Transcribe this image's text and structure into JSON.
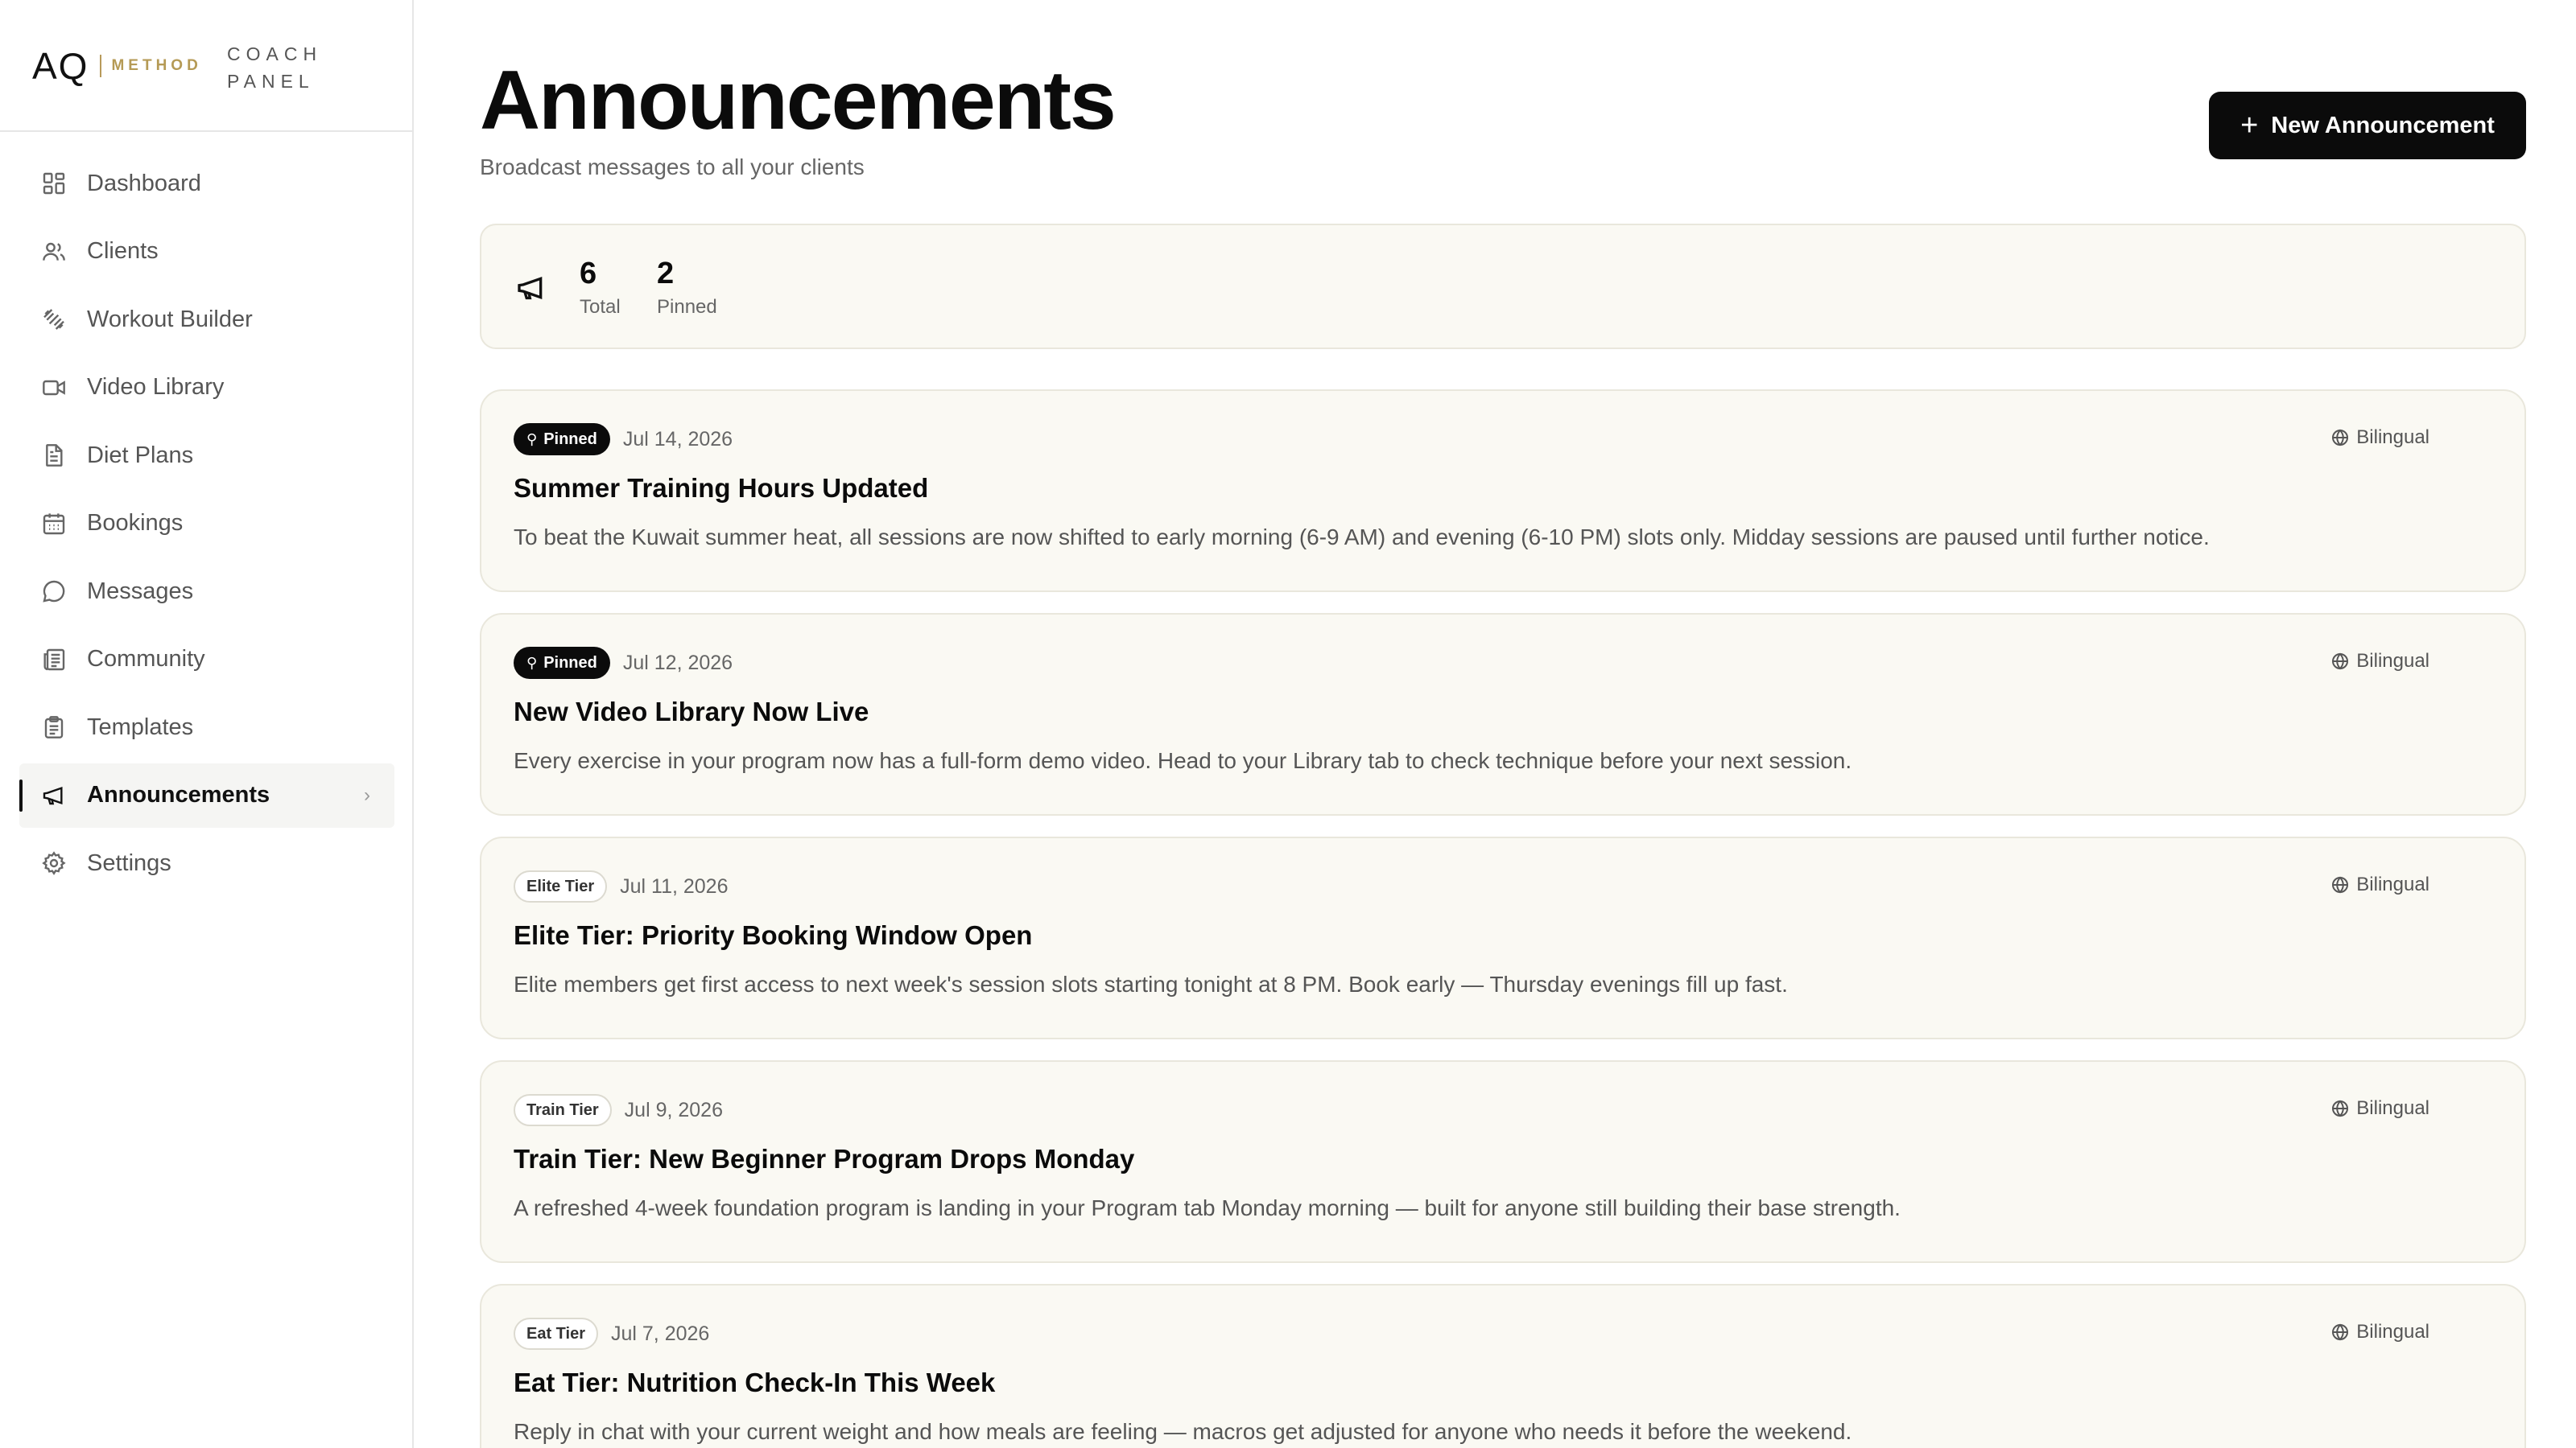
{
  "brand": {
    "logo": "AQ",
    "method": "METHOD",
    "panel_line1": "COACH",
    "panel_line2": "PANEL"
  },
  "sidebar": {
    "items": [
      {
        "label": "Dashboard",
        "icon": "grid-icon"
      },
      {
        "label": "Clients",
        "icon": "users-icon"
      },
      {
        "label": "Workout Builder",
        "icon": "dumbbell-icon"
      },
      {
        "label": "Video Library",
        "icon": "video-icon"
      },
      {
        "label": "Diet Plans",
        "icon": "document-icon"
      },
      {
        "label": "Bookings",
        "icon": "calendar-icon"
      },
      {
        "label": "Messages",
        "icon": "chat-icon"
      },
      {
        "label": "Community",
        "icon": "newspaper-icon"
      },
      {
        "label": "Templates",
        "icon": "clipboard-icon"
      },
      {
        "label": "Announcements",
        "icon": "megaphone-icon",
        "active": true
      },
      {
        "label": "Settings",
        "icon": "gear-icon"
      }
    ]
  },
  "header": {
    "title": "Announcements",
    "subtitle": "Broadcast messages to all your clients",
    "new_button_label": "New Announcement"
  },
  "stats": {
    "total_value": "6",
    "total_label": "Total",
    "pinned_value": "2",
    "pinned_label": "Pinned"
  },
  "announcements": [
    {
      "badge": "Pinned",
      "badge_type": "pinned",
      "date": "Jul 14, 2026",
      "language": "Bilingual",
      "title": "Summer Training Hours Updated",
      "body": "To beat the Kuwait summer heat, all sessions are now shifted to early morning (6-9 AM) and evening (6-10 PM) slots only. Midday sessions are paused until further notice."
    },
    {
      "badge": "Pinned",
      "badge_type": "pinned",
      "date": "Jul 12, 2026",
      "language": "Bilingual",
      "title": "New Video Library Now Live",
      "body": "Every exercise in your program now has a full-form demo video. Head to your Library tab to check technique before your next session."
    },
    {
      "badge": "Elite Tier",
      "badge_type": "tier",
      "date": "Jul 11, 2026",
      "language": "Bilingual",
      "title": "Elite Tier: Priority Booking Window Open",
      "body": "Elite members get first access to next week's session slots starting tonight at 8 PM. Book early — Thursday evenings fill up fast."
    },
    {
      "badge": "Train Tier",
      "badge_type": "tier",
      "date": "Jul 9, 2026",
      "language": "Bilingual",
      "title": "Train Tier: New Beginner Program Drops Monday",
      "body": "A refreshed 4-week foundation program is landing in your Program tab Monday morning — built for anyone still building their base strength."
    },
    {
      "badge": "Eat Tier",
      "badge_type": "tier",
      "date": "Jul 7, 2026",
      "language": "Bilingual",
      "title": "Eat Tier: Nutrition Check-In This Week",
      "body": "Reply in chat with your current weight and how meals are feeling — macros get adjusted for anyone who needs it before the weekend."
    }
  ]
}
